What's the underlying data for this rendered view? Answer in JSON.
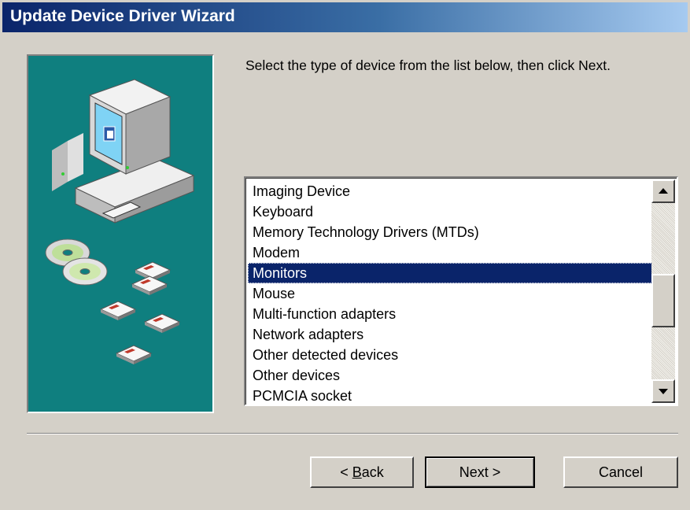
{
  "window": {
    "title": "Update Device Driver Wizard",
    "colors": {
      "title_start": "#0a246a",
      "title_end": "#a6caf0",
      "face": "#d4d0c8",
      "picture_bg": "#0f7f7f",
      "selection": "#0a246a"
    }
  },
  "picture": {
    "icons": [
      "computer-icon",
      "cd-icon",
      "floppy-disk-icon"
    ]
  },
  "main": {
    "instruction": "Select the type of device from the list below, then click Next."
  },
  "device_list": {
    "items": [
      "Imaging Device",
      "Keyboard",
      "Memory Technology Drivers (MTDs)",
      "Modem",
      "Monitors",
      "Mouse",
      "Multi-function adapters",
      "Network adapters",
      "Other detected devices",
      "Other devices",
      "PCMCIA socket"
    ],
    "selected": "Monitors"
  },
  "buttons": {
    "back_prefix": "< ",
    "back_mnemonic": "B",
    "back_rest": "ack",
    "next": "Next >",
    "cancel": "Cancel"
  }
}
